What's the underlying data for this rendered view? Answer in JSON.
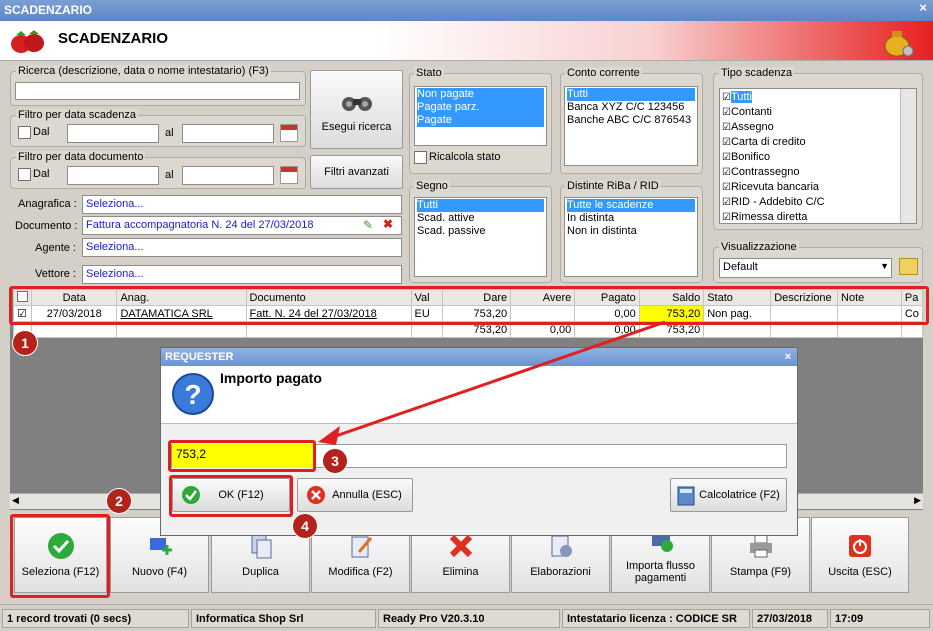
{
  "window": {
    "title": "SCADENZARIO",
    "close": "×"
  },
  "header": {
    "title": "SCADENZARIO"
  },
  "search": {
    "label": "Ricerca (descrizione, data o nome intestatario) (F3)",
    "value": ""
  },
  "scad_filter": {
    "label": "Filtro per data scadenza",
    "dal": "Dal",
    "al": "al"
  },
  "doc_filter": {
    "label": "Filtro per data documento",
    "dal": "Dal",
    "al": "al"
  },
  "buttons": {
    "esegui": "Esegui ricerca",
    "filtri": "Filtri avanzati"
  },
  "fields": {
    "anagrafica_label": "Anagrafica :",
    "anagrafica": "Seleziona...",
    "documento_label": "Documento :",
    "documento": "Fattura accompagnatoria N. 24 del 27/03/2018",
    "agente_label": "Agente :",
    "agente": "Seleziona...",
    "vettore_label": "Vettore :",
    "vettore": "Seleziona..."
  },
  "stato": {
    "label": "Stato",
    "items": [
      "Non pagate",
      "Pagate parz.",
      "Pagate"
    ],
    "ricalcola": "Ricalcola stato"
  },
  "conto": {
    "label": "Conto corrente",
    "items": [
      "Tutti",
      "Banca XYZ C/C 123456",
      "Banche ABC C/C 876543"
    ]
  },
  "segno": {
    "label": "Segno",
    "items": [
      "Tutti",
      "Scad. attive",
      "Scad. passive"
    ]
  },
  "distinte": {
    "label": "Distinte RiBa / RID",
    "items": [
      "Tutte le scadenze",
      "In distinta",
      "Non in distinta"
    ]
  },
  "tipo": {
    "label": "Tipo scadenza",
    "items": [
      "Tutti",
      "Contanti",
      "Assegno",
      "Carta di credito",
      "Bonifico",
      "Contrassegno",
      "Ricevuta bancaria",
      "RID - Addebito C/C",
      "Rimessa diretta"
    ]
  },
  "visualizzazione": {
    "label": "Visualizzazione",
    "value": "Default"
  },
  "grid": {
    "headers": [
      "Data",
      "Anag.",
      "Documento",
      "Val",
      "Dare",
      "Avere",
      "Pagato",
      "Saldo",
      "Stato",
      "Descrizione",
      "Note",
      "Pa"
    ],
    "row": {
      "data": "27/03/2018",
      "anag": "DATAMATICA SRL",
      "documento": "Fatt. N. 24 del 27/03/2018",
      "val": "EU",
      "dare": "753,20",
      "avere": "",
      "pagato": "0,00",
      "saldo": "753,20",
      "stato": "Non pag.",
      "descrizione": "",
      "note": "",
      "pa": "Co"
    },
    "totals": {
      "dare": "753,20",
      "avere": "0,00",
      "pagato": "0,00",
      "saldo": "753,20"
    }
  },
  "dialog": {
    "title": "REQUESTER",
    "close": "×",
    "heading": "Importo pagato",
    "value": "753,2",
    "ok": "OK (F12)",
    "annulla": "Annulla (ESC)",
    "calc": "Calcolatrice (F2)"
  },
  "badges": [
    "1",
    "2",
    "3",
    "4"
  ],
  "toolbar": [
    "Seleziona (F12)",
    "Nuovo (F4)",
    "Duplica",
    "Modifica (F2)",
    "Elimina",
    "Elaborazioni",
    "Importa flusso pagamenti",
    "Stampa (F9)",
    "Uscita (ESC)"
  ],
  "status": {
    "records": "1 record trovati (0 secs)",
    "company": "Informatica Shop Srl",
    "version": "Ready Pro V20.3.10",
    "license": "Intestatario licenza : CODICE SR",
    "date": "27/03/2018",
    "time": "17:09"
  },
  "colors": {
    "accent_red": "#e02020",
    "select_blue": "#3399ff",
    "highlight_yellow": "#ffff00"
  }
}
